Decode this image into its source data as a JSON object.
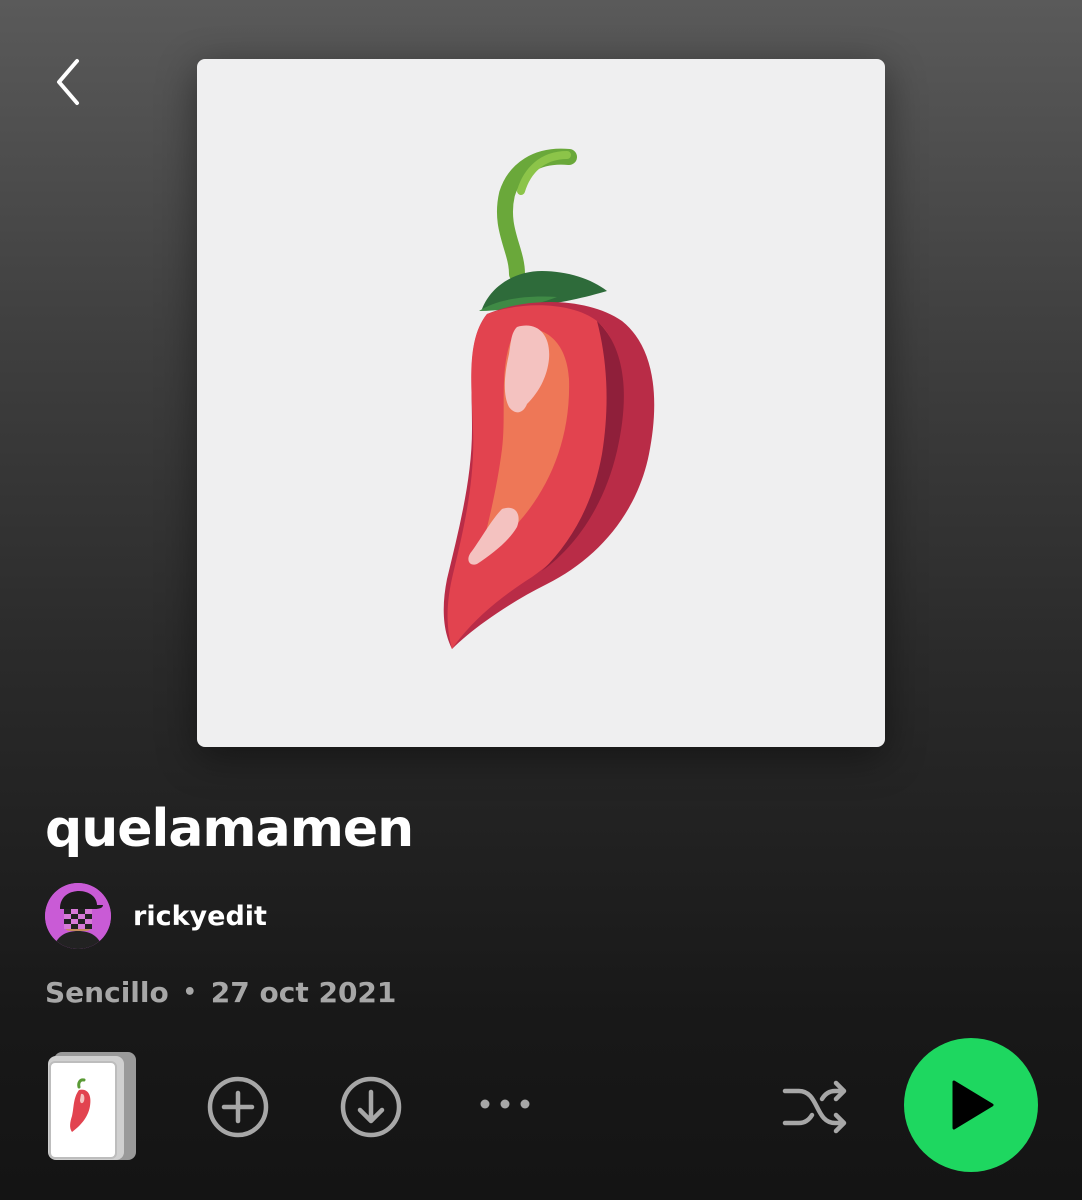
{
  "header": {
    "back_icon": "chevron-left-icon"
  },
  "album": {
    "cover_icon": "chili-pepper-artwork",
    "title": "quelamamen",
    "artist": "rickyedit",
    "type": "Sencillo",
    "separator": "•",
    "release_date": "27 oct 2021"
  },
  "controls": {
    "thumbnail_icon": "album-thumbnail",
    "add_icon": "add-circle-icon",
    "download_icon": "download-circle-icon",
    "more_icon": "more-options-icon",
    "shuffle_icon": "shuffle-icon",
    "play_icon": "play-icon"
  },
  "colors": {
    "accent": "#1ed760",
    "text_primary": "#ffffff",
    "text_secondary": "#a7a7a7",
    "avatar_bg": "#c95bd6"
  }
}
